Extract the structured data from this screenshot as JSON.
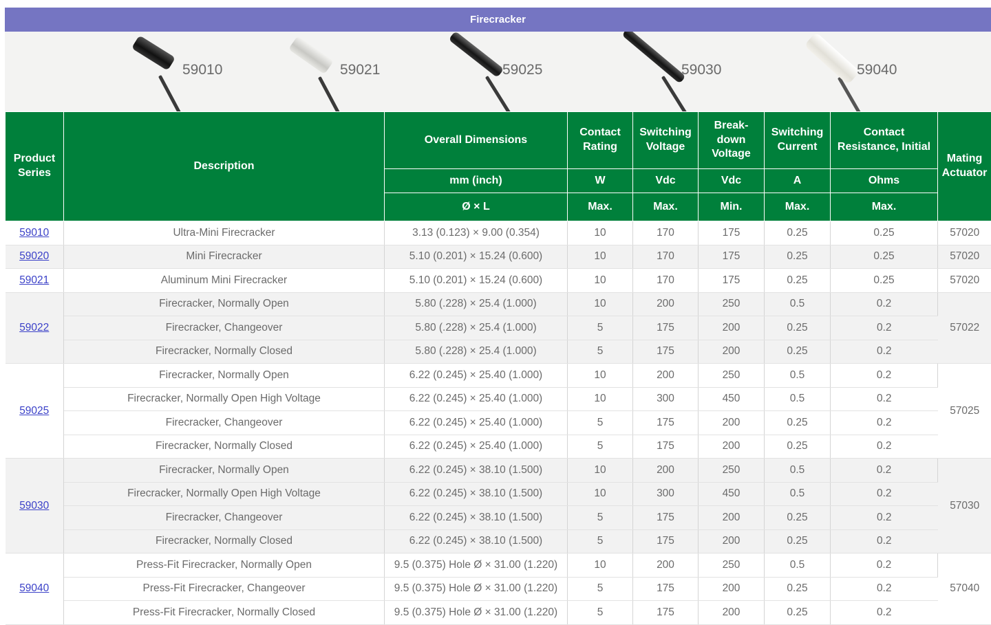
{
  "title": "Firecracker",
  "products": [
    {
      "label": "59010",
      "color": "#232323"
    },
    {
      "label": "59021",
      "color": "#d6d6d2"
    },
    {
      "label": "59025",
      "color": "#2a2a2a"
    },
    {
      "label": "59030",
      "color": "#252525"
    },
    {
      "label": "59040",
      "color": "#e8e6de"
    }
  ],
  "header": {
    "product_series": "Product Series",
    "description": "Description",
    "overall_dimensions": "Overall Dimensions",
    "contact_rating": "Contact Rating",
    "switching_voltage": "Switching Voltage",
    "breakdown_voltage": "Break-down Voltage",
    "switching_current": "Switching Current",
    "contact_resistance": "Contact Resistance, Initial",
    "mating_actuator": "Mating Actuator",
    "units": {
      "dim": "mm (inch)",
      "rating": "W",
      "sw_v": "Vdc",
      "bd_v": "Vdc",
      "current": "A",
      "res": "Ohms"
    },
    "limits": {
      "dim": "Ø × L",
      "rating": "Max.",
      "sw_v": "Max.",
      "bd_v": "Min.",
      "current": "Max.",
      "res": "Max."
    }
  },
  "colors": {
    "title_bar": "#7575c2",
    "header_green": "#00803b",
    "link": "#3b41c8",
    "row_alt": "#f2f2f2"
  },
  "groups": [
    {
      "series": "59010",
      "actuator": "57020",
      "shade": false,
      "rows": [
        {
          "desc": "Ultra-Mini Firecracker",
          "dim": "3.13 (0.123) × 9.00 (0.354)",
          "rating": "10",
          "sw_v": "170",
          "bd_v": "175",
          "current": "0.25",
          "res": "0.25"
        }
      ]
    },
    {
      "series": "59020",
      "actuator": "57020",
      "shade": true,
      "rows": [
        {
          "desc": "Mini Firecracker",
          "dim": "5.10 (0.201) × 15.24 (0.600)",
          "rating": "10",
          "sw_v": "170",
          "bd_v": "175",
          "current": "0.25",
          "res": "0.25"
        }
      ]
    },
    {
      "series": "59021",
      "actuator": "57020",
      "shade": false,
      "rows": [
        {
          "desc": "Aluminum Mini Firecracker",
          "dim": "5.10 (0.201) × 15.24 (0.600)",
          "rating": "10",
          "sw_v": "170",
          "bd_v": "175",
          "current": "0.25",
          "res": "0.25"
        }
      ]
    },
    {
      "series": "59022",
      "actuator": "57022",
      "shade": true,
      "rows": [
        {
          "desc": "Firecracker, Normally Open",
          "dim": "5.80 (.228) × 25.4 (1.000)",
          "rating": "10",
          "sw_v": "200",
          "bd_v": "250",
          "current": "0.5",
          "res": "0.2"
        },
        {
          "desc": "Firecracker, Changeover",
          "dim": "5.80 (.228) × 25.4 (1.000)",
          "rating": "5",
          "sw_v": "175",
          "bd_v": "200",
          "current": "0.25",
          "res": "0.2"
        },
        {
          "desc": "Firecracker, Normally Closed",
          "dim": "5.80 (.228) × 25.4 (1.000)",
          "rating": "5",
          "sw_v": "175",
          "bd_v": "200",
          "current": "0.25",
          "res": "0.2"
        }
      ]
    },
    {
      "series": "59025",
      "actuator": "57025",
      "shade": false,
      "rows": [
        {
          "desc": "Firecracker, Normally Open",
          "dim": "6.22 (0.245) × 25.40 (1.000)",
          "rating": "10",
          "sw_v": "200",
          "bd_v": "250",
          "current": "0.5",
          "res": "0.2"
        },
        {
          "desc": "Firecracker, Normally Open High Voltage",
          "dim": "6.22 (0.245) × 25.40 (1.000)",
          "rating": "10",
          "sw_v": "300",
          "bd_v": "450",
          "current": "0.5",
          "res": "0.2"
        },
        {
          "desc": "Firecracker, Changeover",
          "dim": "6.22 (0.245) × 25.40 (1.000)",
          "rating": "5",
          "sw_v": "175",
          "bd_v": "200",
          "current": "0.25",
          "res": "0.2"
        },
        {
          "desc": "Firecracker, Normally Closed",
          "dim": "6.22 (0.245) × 25.40 (1.000)",
          "rating": "5",
          "sw_v": "175",
          "bd_v": "200",
          "current": "0.25",
          "res": "0.2"
        }
      ]
    },
    {
      "series": "59030",
      "actuator": "57030",
      "shade": true,
      "rows": [
        {
          "desc": "Firecracker, Normally Open",
          "dim": "6.22 (0.245) × 38.10 (1.500)",
          "rating": "10",
          "sw_v": "200",
          "bd_v": "250",
          "current": "0.5",
          "res": "0.2"
        },
        {
          "desc": "Firecracker, Normally Open High Voltage",
          "dim": "6.22 (0.245) × 38.10 (1.500)",
          "rating": "10",
          "sw_v": "300",
          "bd_v": "450",
          "current": "0.5",
          "res": "0.2"
        },
        {
          "desc": "Firecracker, Changeover",
          "dim": "6.22 (0.245) × 38.10 (1.500)",
          "rating": "5",
          "sw_v": "175",
          "bd_v": "200",
          "current": "0.25",
          "res": "0.2"
        },
        {
          "desc": "Firecracker, Normally Closed",
          "dim": "6.22 (0.245) × 38.10 (1.500)",
          "rating": "5",
          "sw_v": "175",
          "bd_v": "200",
          "current": "0.25",
          "res": "0.2"
        }
      ]
    },
    {
      "series": "59040",
      "actuator": "57040",
      "shade": false,
      "rows": [
        {
          "desc": "Press-Fit Firecracker, Normally Open",
          "dim": "9.5 (0.375) Hole Ø × 31.00 (1.220)",
          "rating": "10",
          "sw_v": "200",
          "bd_v": "250",
          "current": "0.5",
          "res": "0.2"
        },
        {
          "desc": "Press-Fit Firecracker, Changeover",
          "dim": "9.5 (0.375) Hole Ø × 31.00 (1.220)",
          "rating": "5",
          "sw_v": "175",
          "bd_v": "200",
          "current": "0.25",
          "res": "0.2"
        },
        {
          "desc": "Press-Fit Firecracker, Normally Closed",
          "dim": "9.5 (0.375) Hole Ø × 31.00 (1.220)",
          "rating": "5",
          "sw_v": "175",
          "bd_v": "200",
          "current": "0.25",
          "res": "0.2"
        }
      ]
    }
  ]
}
